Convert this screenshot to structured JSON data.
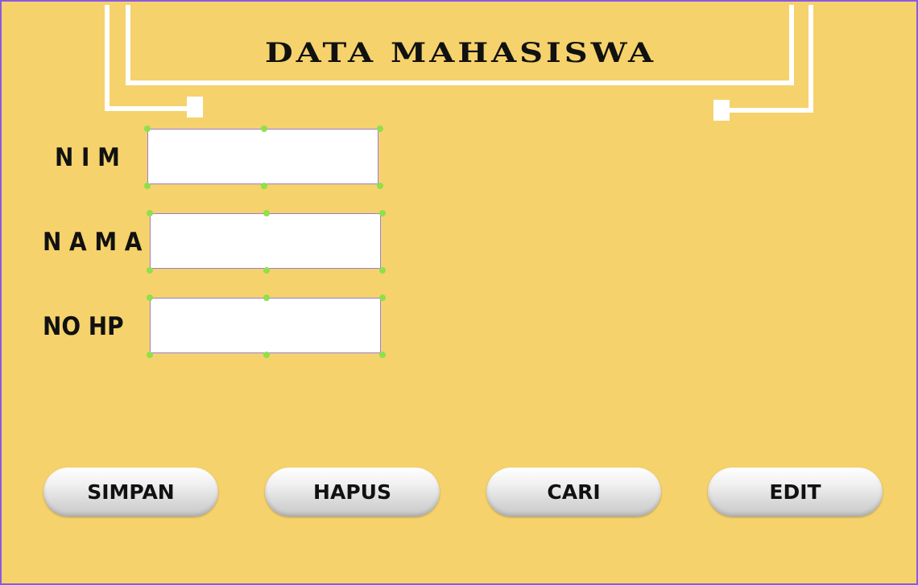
{
  "header": {
    "title": "DATA MAHASISWA"
  },
  "form": {
    "fields": [
      {
        "label": "N I M",
        "value": ""
      },
      {
        "label": "N A M A",
        "value": ""
      },
      {
        "label": "NO HP",
        "value": ""
      }
    ]
  },
  "buttons": {
    "simpan": "SIMPAN",
    "hapus": "HAPUS",
    "cari": "CARI",
    "edit": "EDIT"
  },
  "colors": {
    "background": "#f5d26c",
    "frame_border": "#8a5ae0",
    "handle": "#8fe04a"
  }
}
